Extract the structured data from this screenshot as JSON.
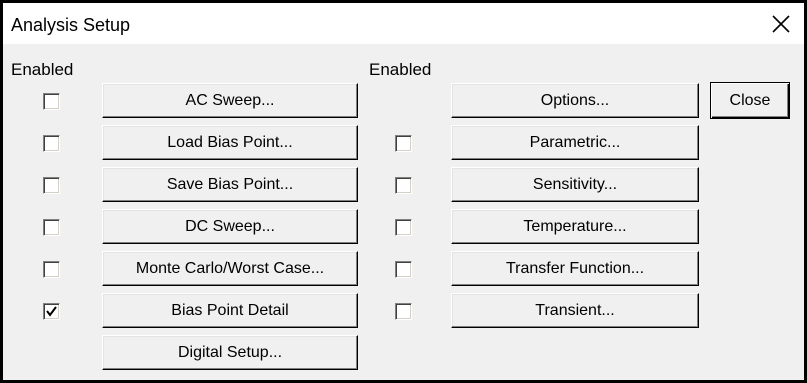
{
  "window": {
    "title": "Analysis Setup"
  },
  "left_column": {
    "header": "Enabled",
    "rows": [
      {
        "label": "AC Sweep...",
        "checkbox": true,
        "checked": false
      },
      {
        "label": "Load Bias Point...",
        "checkbox": true,
        "checked": false
      },
      {
        "label": "Save Bias Point...",
        "checkbox": true,
        "checked": false
      },
      {
        "label": "DC Sweep...",
        "checkbox": true,
        "checked": false
      },
      {
        "label": "Monte Carlo/Worst Case...",
        "checkbox": true,
        "checked": false
      },
      {
        "label": "Bias Point Detail",
        "checkbox": true,
        "checked": true
      },
      {
        "label": "Digital Setup...",
        "checkbox": false,
        "checked": false
      }
    ]
  },
  "right_column": {
    "header": "Enabled",
    "rows": [
      {
        "label": "Options...",
        "checkbox": false,
        "checked": false
      },
      {
        "label": "Parametric...",
        "checkbox": true,
        "checked": false
      },
      {
        "label": "Sensitivity...",
        "checkbox": true,
        "checked": false
      },
      {
        "label": "Temperature...",
        "checkbox": true,
        "checked": false
      },
      {
        "label": "Transfer Function...",
        "checkbox": true,
        "checked": false
      },
      {
        "label": "Transient...",
        "checkbox": true,
        "checked": false
      }
    ]
  },
  "close_button": {
    "label": "Close"
  },
  "icons": {
    "close": "close-icon",
    "check": "checkmark-icon"
  }
}
